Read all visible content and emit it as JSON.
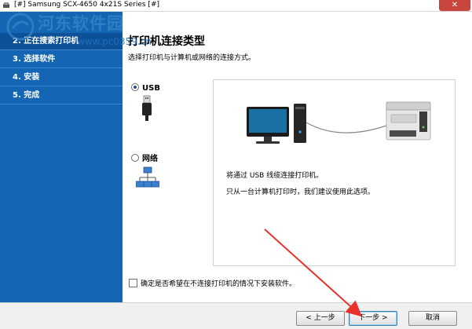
{
  "window": {
    "title": "[#] Samsung SCX-4650 4x21S Series [#]",
    "close_glyph": "✕"
  },
  "watermark": {
    "line1": "河东软件园",
    "line2": "www.pc0359.cn"
  },
  "sidebar": {
    "steps": [
      {
        "label": "2. 正在搜索打印机",
        "active": true
      },
      {
        "label": "3. 选择软件",
        "active": false
      },
      {
        "label": "4. 安装",
        "active": false
      },
      {
        "label": "5. 完成",
        "active": false
      }
    ]
  },
  "main": {
    "heading": "打印机连接类型",
    "subheading": "选择打印机与计算机或网络的连接方式。",
    "options": [
      {
        "label": "USB",
        "selected": true,
        "icon": "usb-icon"
      },
      {
        "label": "网络",
        "selected": false,
        "icon": "network-icon"
      }
    ],
    "panel": {
      "description1": "将通过 USB 线缆连接打印机。",
      "description2": "只从一台计算机打印时，我们建议使用此选项。"
    },
    "checkbox_label": "确定是否希望在不连接打印机的情况下安装软件。",
    "checkbox_checked": false
  },
  "footer": {
    "back_label": "< 上一步",
    "next_label": "下一步 >",
    "cancel_label": "取消"
  },
  "colors": {
    "sidebar": "#1466b4",
    "arrow": "#e8322b"
  }
}
